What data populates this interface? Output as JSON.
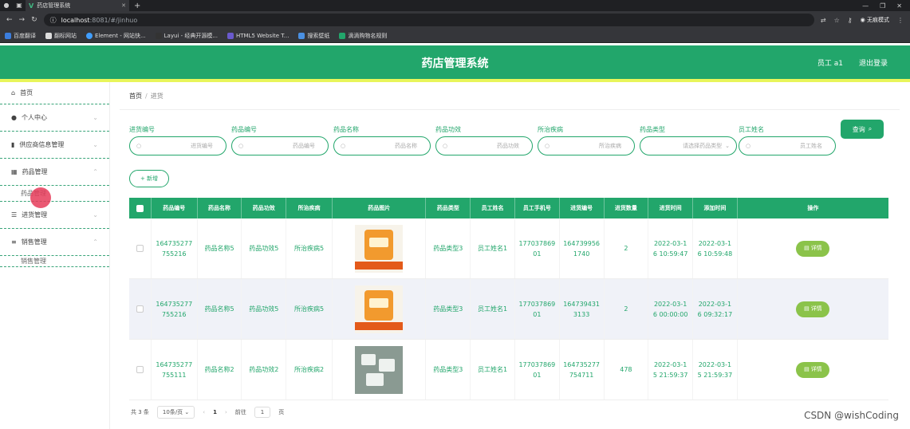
{
  "browser": {
    "tab_title": "药店管理系统",
    "url_host": "localhost",
    "url_rest": ":8081/#/jinhuo",
    "incognito_label": "无痕模式",
    "bookmarks": [
      "百度翻译",
      "翻标网站",
      "Element - 网站快...",
      "Layui - 经典开源模...",
      "HTML5 Website T...",
      "搜索壁纸",
      "滴滴购物名规则"
    ]
  },
  "header": {
    "title": "药店管理系统",
    "user": "员工 a1",
    "logout": "退出登录"
  },
  "sidebar": {
    "items": [
      {
        "icon": "⌂",
        "label": "首页"
      },
      {
        "icon": "👤",
        "label": "个人中心"
      },
      {
        "icon": "▮",
        "label": "供应商信息管理"
      },
      {
        "icon": "▦",
        "label": "药品管理"
      },
      {
        "icon": "",
        "label": "药品管理"
      },
      {
        "icon": "☰",
        "label": "进货管理"
      },
      {
        "icon": "≡",
        "label": "销售管理"
      },
      {
        "icon": "",
        "label": "销售管理"
      }
    ]
  },
  "breadcrumb": {
    "home": "首页",
    "sep": "/",
    "current": "进货"
  },
  "filters": [
    {
      "label": "进货编号",
      "placeholder": "进货编号"
    },
    {
      "label": "药品编号",
      "placeholder": "药品编号"
    },
    {
      "label": "药品名称",
      "placeholder": "药品名称"
    },
    {
      "label": "药品功效",
      "placeholder": "药品功效"
    },
    {
      "label": "所治疾病",
      "placeholder": "所治疾病"
    },
    {
      "label": "药品类型",
      "placeholder": "请选择药品类型"
    },
    {
      "label": "员工姓名",
      "placeholder": "员工姓名"
    }
  ],
  "buttons": {
    "search": "查询",
    "add": "新增",
    "detail": "详情"
  },
  "table": {
    "columns": [
      "药品编号",
      "药品名称",
      "药品功效",
      "所治疾病",
      "药品图片",
      "药品类型",
      "员工姓名",
      "员工手机号",
      "进货编号",
      "进货数量",
      "进货时间",
      "添加时间",
      "操作"
    ],
    "rows": [
      {
        "c0": "164735277\n755216",
        "c1": "药品名称5",
        "c2": "药品功效5",
        "c3": "所治疾病5",
        "c5": "药品类型3",
        "c6": "员工姓名1",
        "c7": "177037869\n01",
        "c8": "164739956\n1740",
        "c9": "2",
        "c10": "2022-03-1\n6 10:59:47",
        "c11": "2022-03-1\n6 10:59:48"
      },
      {
        "c0": "164735277\n755216",
        "c1": "药品名称5",
        "c2": "药品功效5",
        "c3": "所治疾病5",
        "c5": "药品类型3",
        "c6": "员工姓名1",
        "c7": "177037869\n01",
        "c8": "164739431\n3133",
        "c9": "2",
        "c10": "2022-03-1\n6 00:00:00",
        "c11": "2022-03-1\n6 09:32:17"
      },
      {
        "c0": "164735277\n755111",
        "c1": "药品名称2",
        "c2": "药品功效2",
        "c3": "所治疾病2",
        "c5": "药品类型3",
        "c6": "员工姓名1",
        "c7": "177037869\n01",
        "c8": "164735277\n754711",
        "c9": "478",
        "c10": "2022-03-1\n5 21:59:37",
        "c11": "2022-03-1\n5 21:59:37"
      }
    ]
  },
  "pager": {
    "total": "共 3 条",
    "size": "10条/页",
    "page": "1",
    "goto": "前往",
    "goto_value": "1",
    "unit": "页"
  },
  "watermark": "CSDN @wishCoding",
  "colors": {
    "accent": "#22a66b",
    "highlight": "#e8f55a",
    "detail": "#8bc34a"
  }
}
